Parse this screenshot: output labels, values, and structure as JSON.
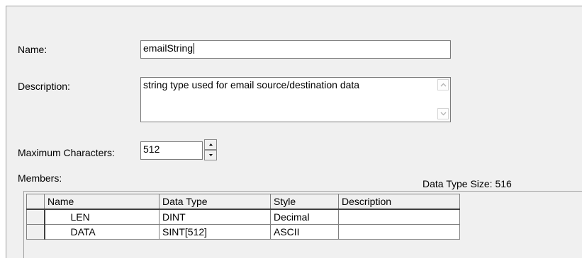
{
  "form": {
    "name_label": "Name:",
    "name_value": "emailString",
    "description_label": "Description:",
    "description_value": "string type used for email source/destination data",
    "max_chars_label": "Maximum Characters:",
    "max_chars_value": "512",
    "members_label": "Members:",
    "data_type_size_label": "Data Type Size: 516"
  },
  "table": {
    "headers": [
      "Name",
      "Data Type",
      "Style",
      "Description"
    ],
    "rows": [
      {
        "name": "LEN",
        "data_type": "DINT",
        "style": "Decimal",
        "description": ""
      },
      {
        "name": "DATA",
        "data_type": "SINT[512]",
        "style": "ASCII",
        "description": ""
      }
    ]
  },
  "icons": {
    "scroll_up": "chevron-up-icon",
    "scroll_down": "chevron-down-icon",
    "spin_up": "spin-up-icon",
    "spin_down": "spin-down-icon"
  }
}
